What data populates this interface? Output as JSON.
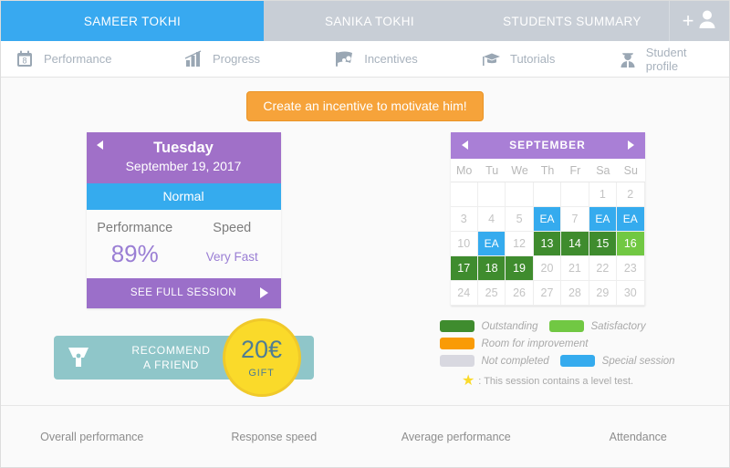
{
  "student_tabs": [
    {
      "label": "SAMEER TOKHI",
      "active": true
    },
    {
      "label": "SANIKA TOKHI",
      "active": false
    },
    {
      "label": "STUDENTS SUMMARY",
      "active": false
    }
  ],
  "add_student": {
    "plus": "+",
    "icon": "add-user-icon"
  },
  "section_nav": [
    {
      "label": "Performance",
      "icon": "calendar-8-icon"
    },
    {
      "label": "Progress",
      "icon": "bar-chart-icon"
    },
    {
      "label": "Incentives",
      "icon": "megaphone-icon"
    },
    {
      "label": "Tutorials",
      "icon": "graduation-cap-icon"
    },
    {
      "label": "Student profile",
      "icon": "user-profile-icon"
    }
  ],
  "incentive_banner": {
    "label": "Create an incentive to motivate him!"
  },
  "session_card": {
    "day": "Tuesday",
    "date": "September 19, 2017",
    "status": "Normal",
    "metrics": [
      {
        "label": "Performance",
        "value": "89%"
      },
      {
        "label": "Speed",
        "value": "Very Fast"
      }
    ],
    "cta": "SEE FULL SESSION"
  },
  "recommend": {
    "line1": "RECOMMEND",
    "line2": "A FRIEND",
    "gift_amount": "20€",
    "gift_label": "GIFT"
  },
  "calendar": {
    "month": "SEPTEMBER",
    "weekdays": [
      "Mo",
      "Tu",
      "We",
      "Th",
      "Fr",
      "Sa",
      "Su"
    ],
    "cells": [
      {
        "label": "",
        "state": "empty"
      },
      {
        "label": "",
        "state": "empty"
      },
      {
        "label": "",
        "state": "empty"
      },
      {
        "label": "",
        "state": "empty"
      },
      {
        "label": "",
        "state": "empty"
      },
      {
        "label": "1",
        "state": "none"
      },
      {
        "label": "2",
        "state": "none"
      },
      {
        "label": "3",
        "state": "none"
      },
      {
        "label": "4",
        "state": "none"
      },
      {
        "label": "5",
        "state": "none"
      },
      {
        "label": "EA",
        "state": "special"
      },
      {
        "label": "7",
        "state": "none"
      },
      {
        "label": "EA",
        "state": "special"
      },
      {
        "label": "EA",
        "state": "special"
      },
      {
        "label": "10",
        "state": "none"
      },
      {
        "label": "EA",
        "state": "special"
      },
      {
        "label": "12",
        "state": "none"
      },
      {
        "label": "13",
        "state": "outstanding"
      },
      {
        "label": "14",
        "state": "outstanding"
      },
      {
        "label": "15",
        "state": "outstanding"
      },
      {
        "label": "16",
        "state": "satisfactory"
      },
      {
        "label": "17",
        "state": "outstanding"
      },
      {
        "label": "18",
        "state": "outstanding"
      },
      {
        "label": "19",
        "state": "outstanding"
      },
      {
        "label": "20",
        "state": "none"
      },
      {
        "label": "21",
        "state": "none"
      },
      {
        "label": "22",
        "state": "none"
      },
      {
        "label": "23",
        "state": "none"
      },
      {
        "label": "24",
        "state": "none"
      },
      {
        "label": "25",
        "state": "none"
      },
      {
        "label": "26",
        "state": "none"
      },
      {
        "label": "27",
        "state": "none"
      },
      {
        "label": "28",
        "state": "none"
      },
      {
        "label": "29",
        "state": "none"
      },
      {
        "label": "30",
        "state": "none"
      }
    ]
  },
  "legend": {
    "rows": [
      [
        {
          "label": "Outstanding",
          "color": "#3f8c2e"
        },
        {
          "label": "Satisfactory",
          "color": "#71c843"
        }
      ],
      [
        {
          "label": "Room for improvement",
          "color": "#f99b06"
        }
      ],
      [
        {
          "label": "Not completed",
          "color": "#d8d8e0"
        },
        {
          "label": "Special session",
          "color": "#35abee"
        }
      ]
    ],
    "note": ": This session contains a level test.",
    "star_icon": "star-icon"
  },
  "bottom_nav": [
    {
      "label": "Overall performance"
    },
    {
      "label": "Response speed"
    },
    {
      "label": "Average performance"
    },
    {
      "label": "Attendance"
    }
  ],
  "colors": {
    "accent_blue": "#38a9f0",
    "tab_grey": "#c8ced6",
    "purple": "#a070c8",
    "purple_dark": "#9b6fc9",
    "purple_cal": "#a97fd6",
    "orange": "#f6a33a",
    "teal": "#8fc6c9",
    "gold": "#fada2a",
    "green_dark": "#3f8c2e",
    "green_light": "#71c843"
  }
}
